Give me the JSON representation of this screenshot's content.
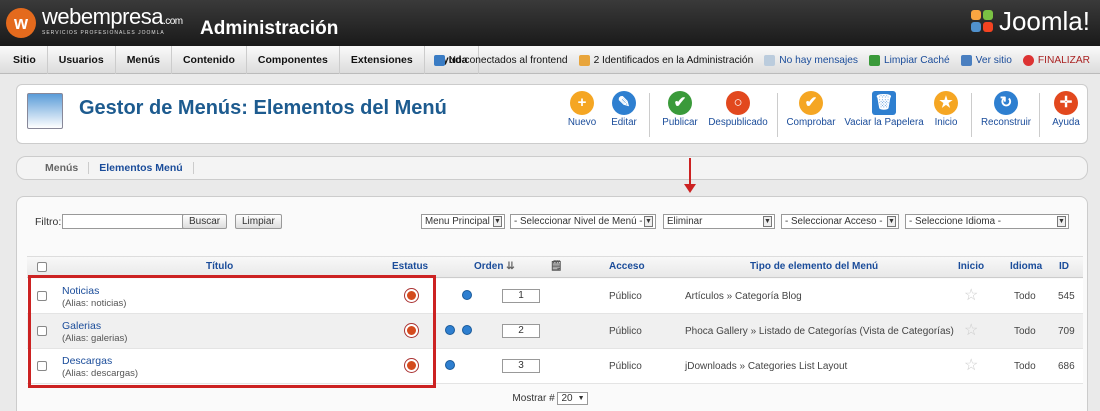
{
  "header": {
    "brand": "webempresa",
    "brand_suffix": ".com",
    "brand_tagline": "SERVICIOS PROFESIONALES JOOMLA",
    "title": "Administración",
    "joomla": "Joomla!"
  },
  "menubar": {
    "items": [
      "Sitio",
      "Usuarios",
      "Menús",
      "Contenido",
      "Componentes",
      "Extensiones",
      "Ayuda"
    ]
  },
  "status": {
    "frontend": "No conectados al frontend",
    "admin": "2 Identificados en la Administración",
    "messages": "No hay mensajes",
    "cache": "Limpiar Caché",
    "site": "Ver sitio",
    "logout": "FINALIZAR"
  },
  "toolbar": {
    "title": "Gestor de Menús: Elementos del Menú",
    "buttons": [
      {
        "label": "Nuevo",
        "color": "#f5a623",
        "glyph": "+"
      },
      {
        "label": "Editar",
        "color": "#2e7fd0",
        "glyph": "✎"
      },
      {
        "label": "Publicar",
        "color": "#3a9a3a",
        "glyph": "✔"
      },
      {
        "label": "Despublicado",
        "color": "#e2481e",
        "glyph": "○"
      },
      {
        "label": "Comprobar",
        "color": "#f5a623",
        "glyph": "✔"
      },
      {
        "label": "Vaciar la Papelera",
        "color": "#2e7fd0",
        "glyph": "🗑"
      },
      {
        "label": "Inicio",
        "color": "#f5a623",
        "glyph": "★"
      },
      {
        "label": "Reconstruir",
        "color": "#2e7fd0",
        "glyph": "↻"
      },
      {
        "label": "Ayuda",
        "color": "#e2481e",
        "glyph": "✛"
      }
    ]
  },
  "tabs": [
    "Menús",
    "Elementos Menú"
  ],
  "filter": {
    "label": "Filtro:",
    "search_btn": "Buscar",
    "clear_btn": "Limpiar",
    "menu_select": "Menu Principal",
    "level_select": "- Seleccionar Nivel de Menú -",
    "state_select": "Eliminar",
    "access_select": "- Seleccionar Acceso -",
    "lang_select": "- Seleccione Idioma -"
  },
  "table": {
    "headers": {
      "title": "Título",
      "status": "Estatus",
      "order": "Orden",
      "access": "Acceso",
      "type": "Tipo de elemento del Menú",
      "home": "Inicio",
      "lang": "Idioma",
      "id": "ID"
    },
    "rows": [
      {
        "title": "Noticias",
        "alias": "(Alias: noticias)",
        "order": "1",
        "access": "Público",
        "type": "Artículos » Categoría Blog",
        "lang": "Todo",
        "id": "545"
      },
      {
        "title": "Galerias",
        "alias": "(Alias: galerias)",
        "order": "2",
        "access": "Público",
        "type": "Phoca Gallery » Listado de Categorías (Vista de Categorías)",
        "lang": "Todo",
        "id": "709"
      },
      {
        "title": "Descargas",
        "alias": "(Alias: descargas)",
        "order": "3",
        "access": "Público",
        "type": "jDownloads » Categories List Layout",
        "lang": "Todo",
        "id": "686"
      }
    ]
  },
  "footer": {
    "label": "Mostrar #",
    "value": "20"
  }
}
